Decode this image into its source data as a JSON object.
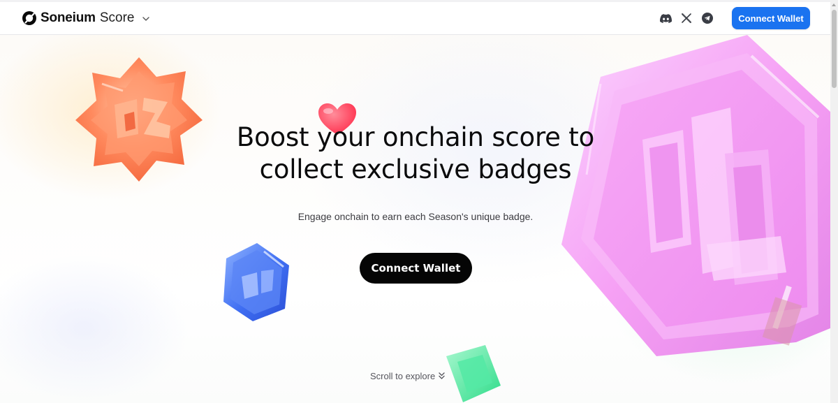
{
  "header": {
    "brand_name": "Soneium",
    "brand_suffix": "Score",
    "social_icons": [
      "discord-icon",
      "x-icon",
      "telegram-icon"
    ],
    "connect_label": "Connect Wallet"
  },
  "hero": {
    "headline_line1": "Boost your onchain score to",
    "headline_line2": "collect exclusive badges",
    "subtext": "Engage onchain to earn each Season's unique badge.",
    "cta_label": "Connect Wallet",
    "scroll_hint": "Scroll to explore"
  },
  "colors": {
    "accent": "#1a73f0",
    "cta": "#050505",
    "badge_orange": "#ff7a52",
    "badge_pink": "#f48cf0",
    "badge_blue": "#3e6ef0",
    "badge_green": "#3ee39a",
    "heart": "#ff3d55"
  }
}
